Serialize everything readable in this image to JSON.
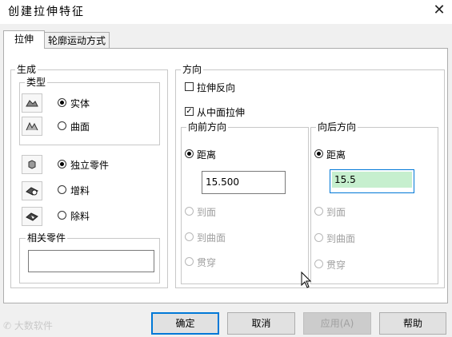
{
  "window": {
    "title": "创建拉伸特征",
    "close_icon": "close-icon"
  },
  "tabs": [
    {
      "label": "拉伸",
      "active": true
    },
    {
      "label": "轮廓运动方式",
      "active": false
    }
  ],
  "generate": {
    "group_label": "生成",
    "type_label": "类型",
    "types": [
      {
        "label": "实体",
        "selected": true,
        "icon": "solid-body-icon"
      },
      {
        "label": "曲面",
        "selected": false,
        "icon": "surface-body-icon"
      }
    ],
    "parts": [
      {
        "label": "独立零件",
        "selected": true,
        "icon": "independent-part-icon"
      },
      {
        "label": "增料",
        "selected": false,
        "icon": "add-material-icon"
      },
      {
        "label": "除料",
        "selected": false,
        "icon": "remove-material-icon"
      }
    ],
    "related_label": "相关零件",
    "related_value": ""
  },
  "direction": {
    "group_label": "方向",
    "reverse_label": "拉伸反向",
    "reverse_checked": false,
    "from_middle_label": "从中面拉伸",
    "from_middle_checked": true,
    "forward": {
      "label": "向前方向",
      "distance_label": "距离",
      "distance_value": "15.500",
      "to_face": "到面",
      "to_surface": "到曲面",
      "through": "贯穿"
    },
    "backward": {
      "label": "向后方向",
      "distance_label": "距离",
      "distance_value": "15.5",
      "to_face": "到面",
      "to_surface": "到曲面",
      "through": "贯穿"
    }
  },
  "buttons": {
    "ok": "确定",
    "cancel": "取消",
    "apply": "应用(A)",
    "help": "帮助"
  },
  "watermark": "大数软件",
  "colors": {
    "accent": "#0078d7",
    "highlight": "#c6efce"
  }
}
